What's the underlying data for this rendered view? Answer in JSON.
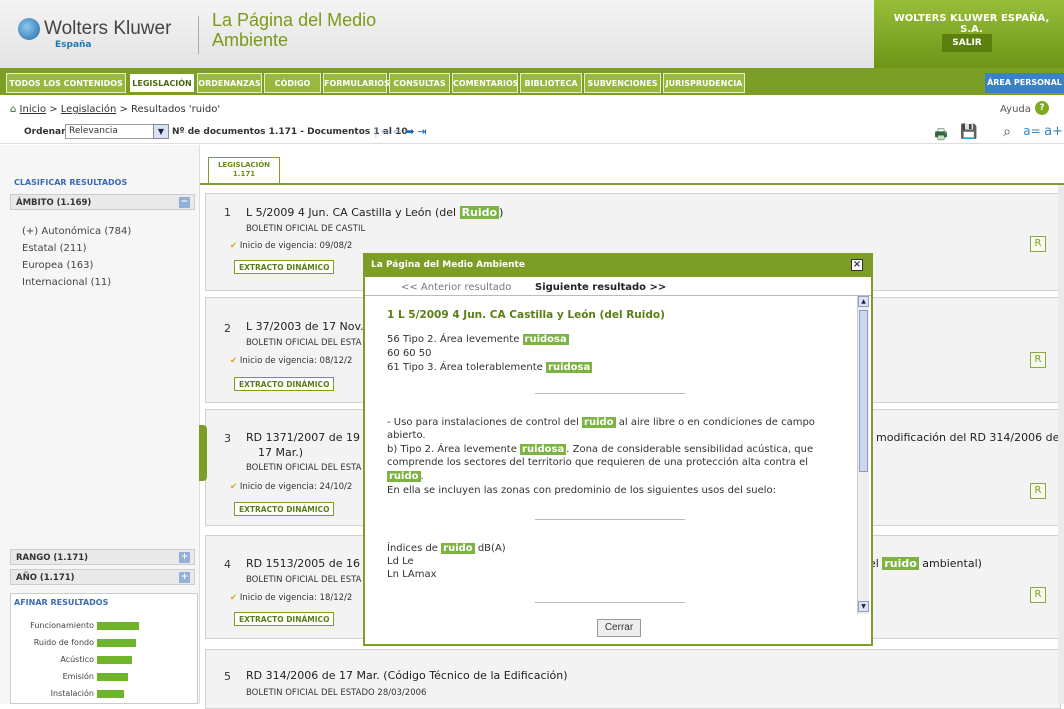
{
  "header": {
    "brand": "Wolters Kluwer",
    "brand_sub": "España",
    "site_title": "La Página del Medio Ambiente",
    "company": "WOLTERS KLUWER ESPAÑA, S.A.",
    "logout": "SALIR"
  },
  "nav": {
    "tabs": [
      "TODOS LOS CONTENIDOS",
      "LEGISLACIÓN",
      "ORDENANZAS",
      "CÓDIGO",
      "FORMULARIOS",
      "CONSULTAS",
      "COMENTARIOS",
      "BIBLIOTECA",
      "SUBVENCIONES",
      "JURISPRUDENCIA"
    ],
    "area_personal": "ÁREA PERSONAL"
  },
  "breadcrumb": {
    "inicio": "Inicio",
    "sep1": " > ",
    "legislacion": "Legislación",
    "rest": " > Resultados 'ruido'",
    "ayuda": "Ayuda"
  },
  "toolbar": {
    "ordenar_label": "Ordenar",
    "ordenar_value": "Relevancia",
    "docs_count": "Nº de documentos 1.171 - Documentos 1 al 10"
  },
  "sidebar": {
    "clasificar": "CLASIFICAR RESULTADOS",
    "ambito": "ÁMBITO (1.169)",
    "items": [
      "(+) Autonómica (784)",
      "Estatal (211)",
      "Europea (163)",
      "Internacional (11)"
    ],
    "rango": "RANGO (1.171)",
    "anio": "AÑO (1.171)",
    "afinar": "AFINAR RESULTADOS",
    "bars": [
      {
        "label": "Funcionamiento",
        "value": 1.0
      },
      {
        "label": "Ruido de fondo",
        "value": 0.94
      },
      {
        "label": "Acústico",
        "value": 0.83
      },
      {
        "label": "Emisión",
        "value": 0.74
      },
      {
        "label": "Instalación",
        "value": 0.65
      }
    ]
  },
  "results": {
    "tab_label": "LEGISLACIÓN",
    "tab_count": "1.171",
    "extracto": "EXTRACTO DINÁMICO",
    "r_btn": "R",
    "items": [
      {
        "num": "1",
        "title": "L 5/2009 4 Jun. CA Castilla y León (del ",
        "hl": "Ruido",
        "after": ")",
        "sub": "BOLETIN OFICIAL DE CASTIL",
        "vig": "Inicio de vigencia: 09/08/2"
      },
      {
        "num": "2",
        "title": "L 37/2003 de 17 Nov.",
        "sub": "BOLETIN OFICIAL DEL ESTA",
        "vig": "Inicio de vigencia: 08/12/2"
      },
      {
        "num": "3",
        "title": "RD 1371/2007 de 19",
        "title2": "17 Mar.)",
        "tail": "modificación del RD 314/2006 de",
        "sub": "BOLETIN OFICIAL DEL ESTA",
        "vig": "Inicio de vigencia: 24/10/2"
      },
      {
        "num": "4",
        "title": "RD 1513/2005 de 16",
        "tail_pre": "el ",
        "tail_hl": "ruido",
        "tail_post": " ambiental)",
        "sub": "BOLETIN OFICIAL DEL ESTA",
        "vig": "Inicio de vigencia: 18/12/2"
      },
      {
        "num": "5",
        "title": "RD 314/2006 de 17 Mar. (Código Técnico de la Edificación)",
        "sub": "BOLETIN OFICIAL DEL ESTADO  28/03/2006"
      }
    ]
  },
  "dialog": {
    "title": "La Página del Medio Ambiente",
    "prev": "<<  Anterior resultado",
    "next": "Siguiente resultado  >>",
    "doc_title": "1  L 5/2009 4 Jun. CA Castilla y León (del Ruido)",
    "l1_a": "56 Tipo 2. Área levemente ",
    "l1_hl": "ruidosa",
    "l2": "60 60 50",
    "l3_a": "61 Tipo 3. Área tolerablemente ",
    "l3_hl": "ruidosa",
    "p1_a": "- Uso para instalaciones de control del ",
    "p1_hl": "ruido",
    "p1_b": " al aire libre o en condiciones de campo",
    "p1_c": "abierto.",
    "p2_a": "b) Tipo 2. Área levemente ",
    "p2_hl": "ruidosa",
    "p2_b": ". Zona de considerable sensibilidad acústica, que",
    "p2_c": "comprende los sectores del territorio que requieren de una protección alta contra el",
    "p2_hl2": "ruido",
    "p2_d": ".",
    "p3": "En ella se incluyen las zonas con predominio de los siguientes usos del suelo:",
    "i1_a": "Índices de ",
    "i1_hl": "ruido",
    "i1_b": " dB(A)",
    "i2": "Ld Le",
    "i3": "Ln LAmax",
    "close": "Cerrar"
  }
}
